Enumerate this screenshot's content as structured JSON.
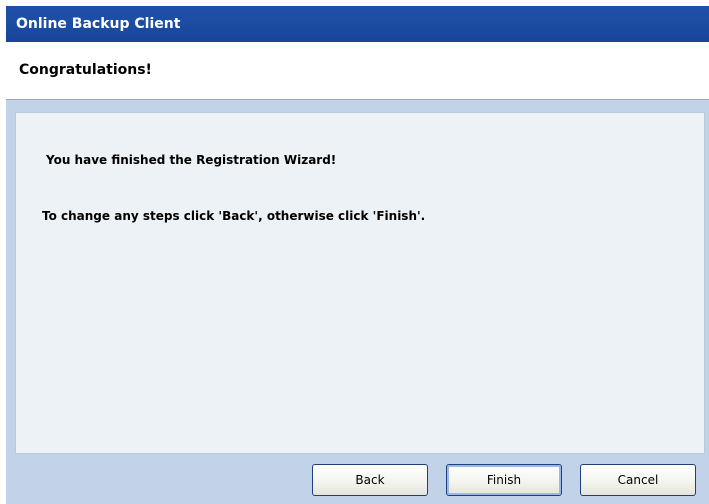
{
  "window": {
    "title": "Online Backup Client"
  },
  "header": {
    "title": "Congratulations!"
  },
  "content": {
    "line1": "You have finished the Registration Wizard!",
    "line2": "To change any steps click 'Back', otherwise click 'Finish'."
  },
  "buttons": {
    "back": "Back",
    "finish": "Finish",
    "cancel": "Cancel"
  }
}
